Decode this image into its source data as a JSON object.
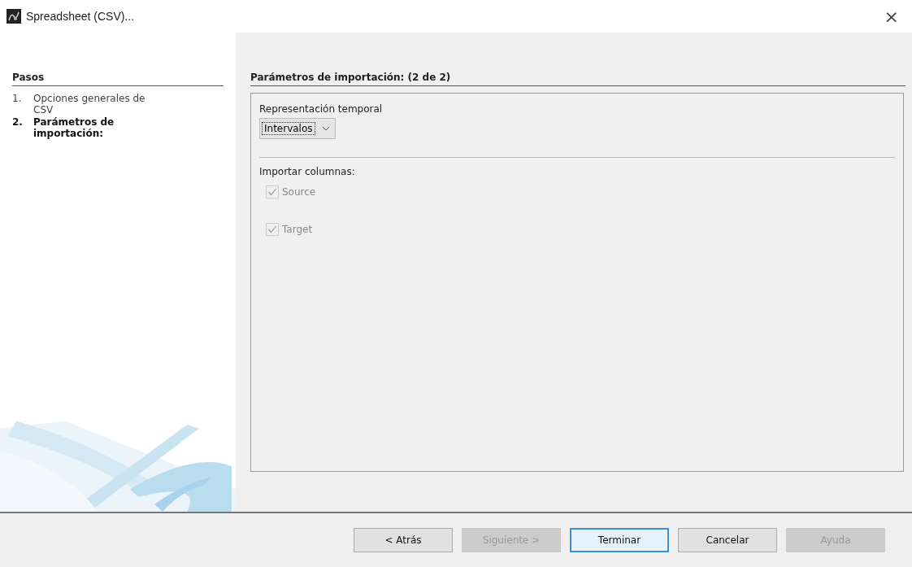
{
  "window": {
    "title": "Spreadsheet (CSV)...",
    "close": "×"
  },
  "steps": {
    "title": "Pasos",
    "items": [
      {
        "number": "1.",
        "label": "Opciones generales de CSV",
        "selected": false
      },
      {
        "number": "2.",
        "label": "Parámetros de importación:",
        "selected": true
      }
    ]
  },
  "panel": {
    "title": "Parámetros de importación: (2 de 2)",
    "time_label": "Representación temporal",
    "time_select": {
      "value": "Intervalos"
    },
    "columns_label": "Importar columnas:",
    "columns": [
      {
        "label": "Source",
        "checked": true,
        "disabled": true
      },
      {
        "label": "Target",
        "checked": true,
        "disabled": true
      }
    ]
  },
  "buttons": [
    {
      "label": "< Atrás",
      "disabled": false,
      "default": false
    },
    {
      "label": "Siguiente >",
      "disabled": true,
      "default": false
    },
    {
      "label": "Terminar",
      "disabled": false,
      "default": true
    },
    {
      "label": "Cancelar",
      "disabled": false,
      "default": false
    },
    {
      "label": "Ayuda",
      "disabled": true,
      "default": false
    }
  ]
}
